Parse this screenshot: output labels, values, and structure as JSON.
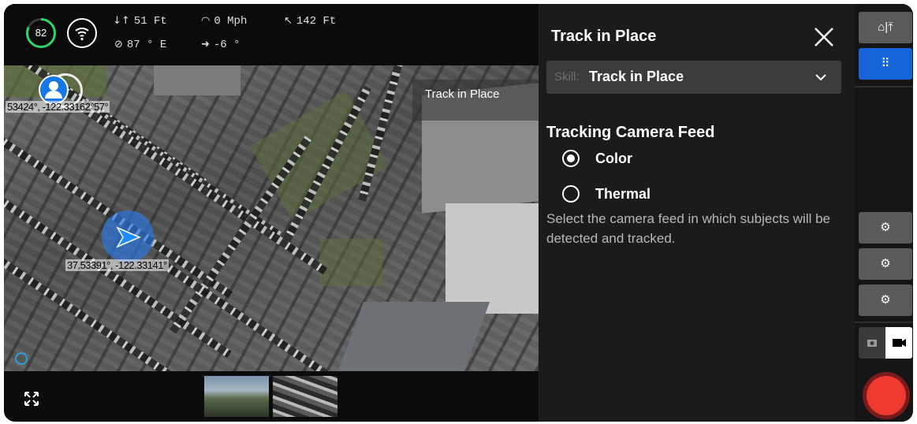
{
  "telemetry": {
    "battery_percent": "82",
    "altitude": "51 Ft",
    "speed": "0 Mph",
    "distance": "142 Ft",
    "heading": "87 ° E",
    "gimbal_pitch": "-6 °"
  },
  "map": {
    "overlay_label": "Track in Place",
    "user_coord": "53424°, -122.33162°57°",
    "drone_coord": "37.53391°, -122.33141°"
  },
  "panel": {
    "title": "Track in Place",
    "skill_prefix": "Skill:",
    "skill_value": "Track in Place",
    "section_title": "Tracking Camera Feed",
    "options": [
      {
        "label": "Color",
        "selected": true
      },
      {
        "label": "Thermal",
        "selected": false
      }
    ],
    "description": "Select the camera feed in which subjects will be detected and tracked."
  },
  "colors": {
    "accent_blue": "#1877e8",
    "record_red": "#ee3a2e",
    "battery_green": "#2fd46a"
  },
  "icons": [
    "wifi-icon",
    "altitude-icon",
    "speed-icon",
    "distance-icon",
    "compass-icon",
    "gimbal-icon",
    "close-icon",
    "chevron-down-icon",
    "home-upload-icon",
    "grid-icon",
    "fullscreen-icon",
    "camera-icon",
    "video-icon"
  ]
}
